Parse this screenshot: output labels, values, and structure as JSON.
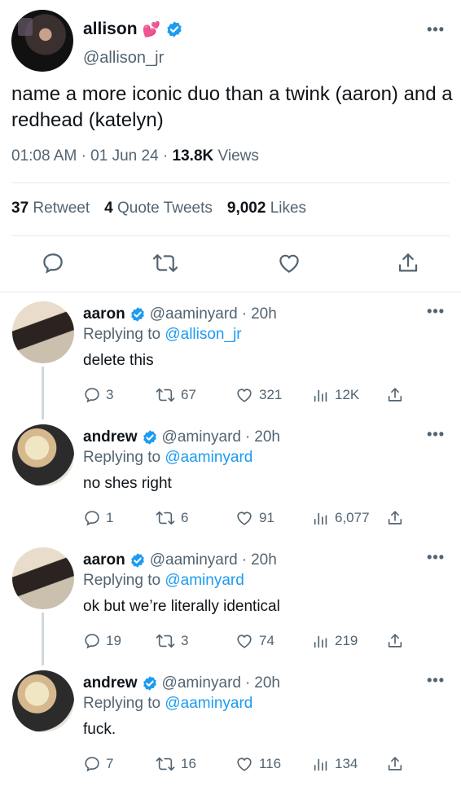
{
  "main_tweet": {
    "author_name": "allison",
    "name_emoji": "💕",
    "author_handle": "@allison_jr",
    "text": "name a more iconic duo than a twink (aaron) and a redhead (katelyn)",
    "time": "01:08 AM",
    "date": "01 Jun 24",
    "views_count": "13.8K",
    "views_label": "Views",
    "retweets_count": "37",
    "retweets_label": "Retweet",
    "quotes_count": "4",
    "quotes_label": "Quote Tweets",
    "likes_count": "9,002",
    "likes_label": "Likes"
  },
  "replying_to_label": "Replying to",
  "replies": [
    {
      "name": "aaron",
      "handle": "@aaminyard",
      "time": "20h",
      "replying_to": "@allison_jr",
      "text": "delete this",
      "replies": "3",
      "retweets": "67",
      "likes": "321",
      "views": "12K"
    },
    {
      "name": "andrew",
      "handle": "@aminyard",
      "time": "20h",
      "replying_to": "@aaminyard",
      "text": "no shes right",
      "replies": "1",
      "retweets": "6",
      "likes": "91",
      "views": "6,077"
    },
    {
      "name": "aaron",
      "handle": "@aaminyard",
      "time": "20h",
      "replying_to": "@aminyard",
      "text": "ok but we’re literally identical",
      "replies": "19",
      "retweets": "3",
      "likes": "74",
      "views": "219"
    },
    {
      "name": "andrew",
      "handle": "@aminyard",
      "time": "20h",
      "replying_to": "@aaminyard",
      "text": "fuck.",
      "replies": "7",
      "retweets": "16",
      "likes": "116",
      "views": "134"
    }
  ],
  "icons": [
    "verified-badge",
    "more-icon",
    "reply-icon",
    "retweet-icon",
    "like-icon",
    "share-icon",
    "views-icon"
  ],
  "colors": {
    "accent": "#1d9bf0",
    "text": "#0f1419",
    "secondary": "#536471",
    "divider": "#e6e9eb"
  }
}
